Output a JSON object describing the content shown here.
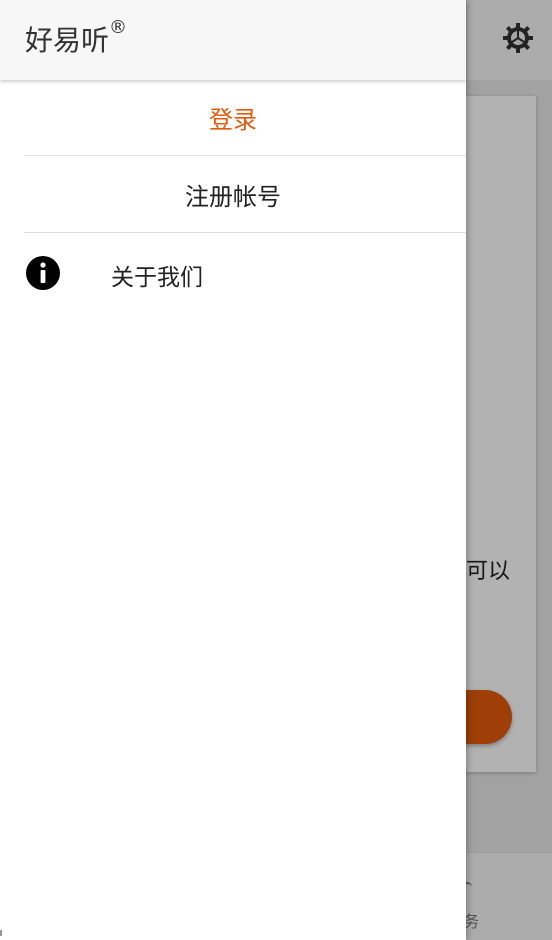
{
  "background": {
    "settings_icon": "gear-icon",
    "card_text": "可以",
    "bottom_label": "务",
    "accent_color": "#e65a0c"
  },
  "drawer": {
    "app_title": "好易听",
    "registered_mark": "®",
    "menu": {
      "login_label": "登录",
      "register_label": "注册帐号",
      "about_label": "关于我们",
      "about_icon": "info-icon"
    }
  }
}
